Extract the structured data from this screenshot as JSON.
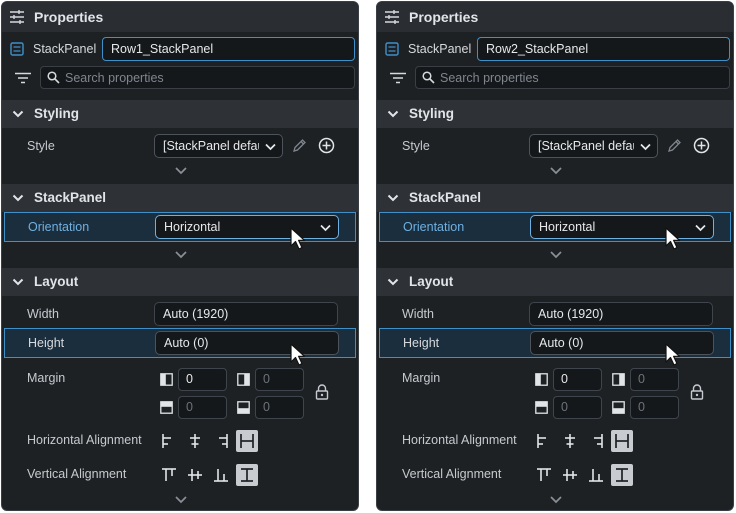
{
  "panels": [
    {
      "title": "Properties",
      "element_type": "StackPanel",
      "element_name": "Row1_StackPanel",
      "search_placeholder": "Search properties",
      "sections": {
        "styling": "Styling",
        "stackpanel": "StackPanel",
        "layout": "Layout"
      },
      "properties": {
        "style_label": "Style",
        "style_value": "[StackPanel default]",
        "orientation_label": "Orientation",
        "orientation_value": "Horizontal",
        "width_label": "Width",
        "width_value": "Auto (1920)",
        "height_label": "Height",
        "height_value": "Auto (0)",
        "margin_label": "Margin",
        "margin_left": "0",
        "margin_right": "0",
        "margin_top": "0",
        "margin_bottom": "0",
        "halign_label": "Horizontal Alignment",
        "valign_label": "Vertical Alignment"
      }
    },
    {
      "title": "Properties",
      "element_type": "StackPanel",
      "element_name": "Row2_StackPanel",
      "search_placeholder": "Search properties",
      "sections": {
        "styling": "Styling",
        "stackpanel": "StackPanel",
        "layout": "Layout"
      },
      "properties": {
        "style_label": "Style",
        "style_value": "[StackPanel default]",
        "orientation_label": "Orientation",
        "orientation_value": "Horizontal",
        "width_label": "Width",
        "width_value": "Auto (1920)",
        "height_label": "Height",
        "height_value": "Auto (0)",
        "margin_label": "Margin",
        "margin_left": "0",
        "margin_right": "0",
        "margin_top": "0",
        "margin_bottom": "0",
        "halign_label": "Horizontal Alignment",
        "valign_label": "Vertical Alignment"
      }
    }
  ],
  "colors": {
    "panel_bg": "#1e2124",
    "section_bg": "#2e3237",
    "accent": "#3f90c9",
    "highlight_bg": "#1b2e3e",
    "highlight_text": "#6fb0e0"
  },
  "icons": {
    "title": "sliders-icon",
    "element": "stackpanel-icon",
    "filter": "filter-icon",
    "search": "search-icon",
    "section": "chevron-down-icon",
    "edit": "pencil-icon",
    "add": "add-circle-icon",
    "lock": "lock-icon",
    "cursor": "mouse-pointer-icon"
  },
  "alignment": {
    "horizontal_selected": "stretch",
    "vertical_selected": "stretch"
  }
}
